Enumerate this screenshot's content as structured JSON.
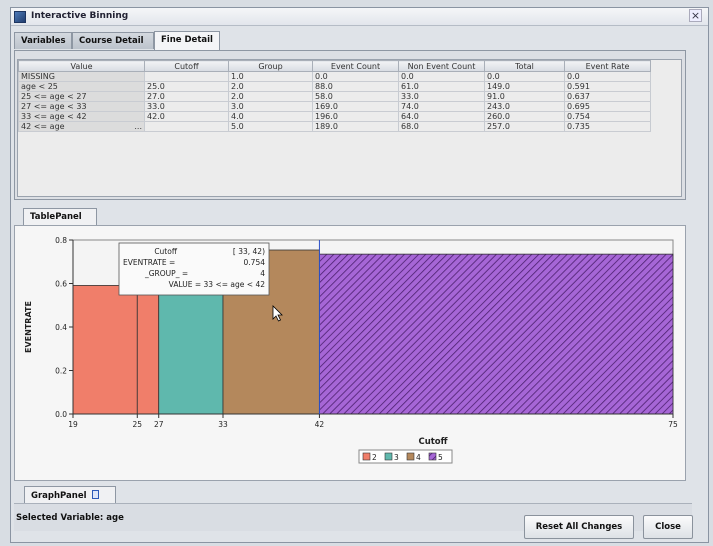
{
  "window": {
    "title": "Interactive Binning",
    "close_glyph": "×"
  },
  "tabs": [
    {
      "label": "Variables"
    },
    {
      "label": "Course Detail"
    },
    {
      "label": "Fine Detail"
    }
  ],
  "table": {
    "columns": [
      "Value",
      "Cutoff",
      "Group",
      "Event Count",
      "Non Event Count",
      "Total",
      "Event Rate"
    ],
    "rows": [
      {
        "value": "MISSING",
        "cutoff": "",
        "group": "1.0",
        "event": "0.0",
        "nonevent": "0.0",
        "total": "0.0",
        "rate": "0.0"
      },
      {
        "value": "age < 25",
        "cutoff": "25.0",
        "group": "2.0",
        "event": "88.0",
        "nonevent": "61.0",
        "total": "149.0",
        "rate": "0.591"
      },
      {
        "value": "25 <= age < 27",
        "cutoff": "27.0",
        "group": "2.0",
        "event": "58.0",
        "nonevent": "33.0",
        "total": "91.0",
        "rate": "0.637"
      },
      {
        "value": "27 <= age < 33",
        "cutoff": "33.0",
        "group": "3.0",
        "event": "169.0",
        "nonevent": "74.0",
        "total": "243.0",
        "rate": "0.695"
      },
      {
        "value": "33 <= age < 42",
        "cutoff": "42.0",
        "group": "4.0",
        "event": "196.0",
        "nonevent": "64.0",
        "total": "260.0",
        "rate": "0.754"
      },
      {
        "value": "42 <= age",
        "cutoff": "",
        "group": "5.0",
        "event": "189.0",
        "nonevent": "68.0",
        "total": "257.0",
        "rate": "0.735"
      }
    ],
    "ellipsis": "..."
  },
  "table_panel_tab": "TablePanel",
  "graph_panel_tab": "GraphPanel",
  "tooltip": {
    "line1_label": "Cutoff",
    "line1_value": "[ 33, 42)",
    "line2_label": "EVENTRATE =",
    "line2_value": "0.754",
    "line3_label": "_GROUP_ =",
    "line3_value": "4",
    "line4": "VALUE = 33 <= age < 42"
  },
  "chart_data": {
    "type": "bar",
    "xlabel": "Cutoff",
    "ylabel": "EVENTRATE",
    "xlim": [
      19,
      75
    ],
    "ylim": [
      0,
      0.8
    ],
    "y_ticks": [
      "0.0",
      "0.2",
      "0.4",
      "0.6",
      "0.8"
    ],
    "x_ticks": [
      "19",
      "25",
      "27",
      "33",
      "42",
      "75"
    ],
    "bars": [
      {
        "x0": 19,
        "x1": 25,
        "value": 0.591,
        "group": "2"
      },
      {
        "x0": 25,
        "x1": 27,
        "value": 0.637,
        "group": "2"
      },
      {
        "x0": 27,
        "x1": 33,
        "value": 0.695,
        "group": "3"
      },
      {
        "x0": 33,
        "x1": 42,
        "value": 0.754,
        "group": "4"
      },
      {
        "x0": 42,
        "x1": 75,
        "value": 0.735,
        "group": "5"
      }
    ],
    "legend": [
      {
        "name": "2",
        "color": "#f07e6a"
      },
      {
        "name": "3",
        "color": "#5fb8ad"
      },
      {
        "name": "4",
        "color": "#b4885c"
      },
      {
        "name": "5",
        "color": "#9b59c4"
      }
    ],
    "highlight_group": "5",
    "grid": false
  },
  "status": {
    "selected_variable": "Selected Variable: age"
  },
  "buttons": {
    "reset": "Reset All Changes",
    "close": "Close"
  }
}
